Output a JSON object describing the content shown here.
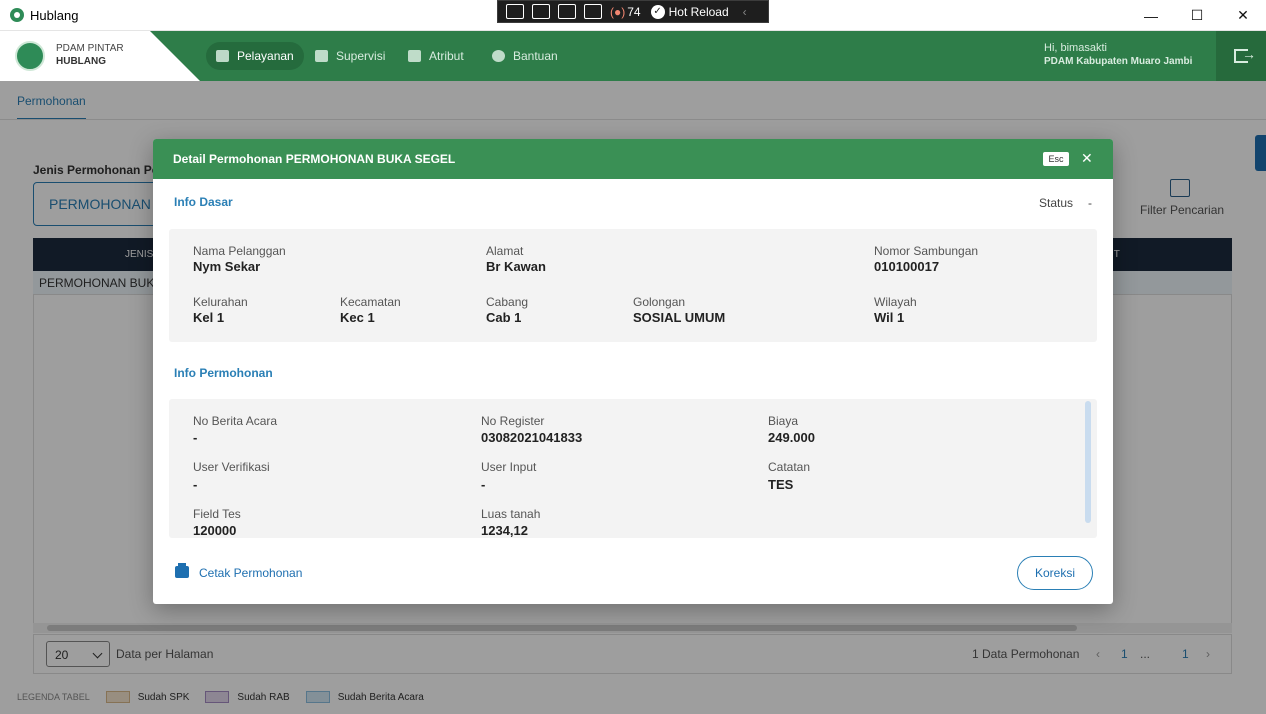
{
  "window": {
    "title": "Hublang",
    "minimize_icon": "—",
    "maximize_icon": "☐",
    "close_icon": "✕"
  },
  "devbar": {
    "counter": "74",
    "hot_reload": "Hot Reload",
    "collapse_icon": "‹"
  },
  "header": {
    "brand_top": "PDAM PINTAR",
    "brand_bottom": "HUBLANG",
    "nav": [
      "Pelayanan",
      "Supervisi",
      "Atribut",
      "Bantuan"
    ],
    "greeting": "Hi, bimasakti",
    "company": "PDAM Kabupaten Muaro Jambi"
  },
  "page": {
    "tab": "Permohonan",
    "jenis_label": "Jenis Permohonan Pelayanan",
    "jenis_value": "PERMOHONAN BUKA SEGEL",
    "filter_label": "Filter Pencarian",
    "table": {
      "col_first": "JENIS",
      "col_last": "IT",
      "row_first": "PERMOHONAN BUKA SEGEL"
    },
    "pager": {
      "per_page_value": "20",
      "per_page_label": "Data per Halaman",
      "count": "1 Data Permohonan",
      "prev": "‹",
      "page_1": "1",
      "ellipsis": "...",
      "page_last": "1",
      "next": "›"
    },
    "legend": {
      "title": "LEGENDA TABEL",
      "items": [
        {
          "label": "Sudah SPK",
          "color": "#f5e6cf",
          "border": "#d9b98a"
        },
        {
          "label": "Sudah RAB",
          "color": "#e4d8ee",
          "border": "#a58bc4"
        },
        {
          "label": "Sudah Berita Acara",
          "color": "#d4e8f5",
          "border": "#8cbfe0"
        }
      ]
    }
  },
  "modal": {
    "title": "Detail Permohonan PERMOHONAN BUKA SEGEL",
    "esc": "Esc",
    "close": "✕",
    "info_dasar_title": "Info Dasar",
    "status_label": "Status",
    "status_value": "-",
    "info_dasar": {
      "nama_pelanggan": {
        "label": "Nama Pelanggan",
        "value": "Nym Sekar"
      },
      "alamat": {
        "label": "Alamat",
        "value": "Br Kawan"
      },
      "nomor_sambungan": {
        "label": "Nomor Sambungan",
        "value": "010100017"
      },
      "kelurahan": {
        "label": "Kelurahan",
        "value": "Kel 1"
      },
      "kecamatan": {
        "label": "Kecamatan",
        "value": "Kec 1"
      },
      "cabang": {
        "label": "Cabang",
        "value": "Cab 1"
      },
      "golongan": {
        "label": "Golongan",
        "value": "SOSIAL UMUM"
      },
      "wilayah": {
        "label": "Wilayah",
        "value": "Wil 1"
      }
    },
    "info_permohonan_title": "Info Permohonan",
    "info_permohonan": {
      "no_berita_acara": {
        "label": "No Berita Acara",
        "value": "-"
      },
      "no_register": {
        "label": "No Register",
        "value": "03082021041833"
      },
      "biaya": {
        "label": "Biaya",
        "value": "249.000"
      },
      "user_verifikasi": {
        "label": "User Verifikasi",
        "value": "-"
      },
      "user_input": {
        "label": "User Input",
        "value": "-"
      },
      "catatan": {
        "label": "Catatan",
        "value": "TES"
      },
      "field_tes": {
        "label": "Field Tes",
        "value": "120000"
      },
      "luas_tanah": {
        "label": "Luas tanah",
        "value": "1234,12"
      }
    },
    "cetak_label": "Cetak Permohonan",
    "koreksi_label": "Koreksi"
  },
  "colors": {
    "header_green": "#2e7d49",
    "modal_header_green": "#3a9055",
    "accent_blue": "#2a7fb5",
    "table_head": "#1c2a3e"
  }
}
